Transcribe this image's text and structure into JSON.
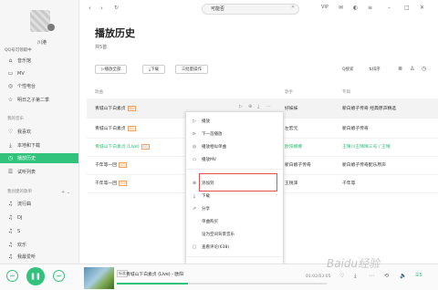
{
  "sidebar": {
    "username": "川港",
    "vip_text": "QQ号可领取中",
    "items_top": [
      {
        "label": "音乐馆",
        "icon": "home-icon"
      },
      {
        "label": "MV",
        "icon": "mv-icon"
      },
      {
        "label": "个性电台",
        "icon": "radio-icon"
      },
      {
        "label": "明日之子第二季",
        "icon": "star-icon"
      }
    ],
    "section_mine": "我的音乐",
    "items_mine": [
      {
        "label": "我喜欢",
        "icon": "heart-icon"
      },
      {
        "label": "本地和下载",
        "icon": "download-icon"
      },
      {
        "label": "播放历史",
        "icon": "history-icon",
        "active": true
      },
      {
        "label": "试听列表",
        "icon": "list-icon"
      }
    ],
    "section_created": "我创建的歌单",
    "created_tools": "+ ⌄",
    "items_created": [
      {
        "label": "流行曲",
        "icon": "note-icon"
      },
      {
        "label": "DJ",
        "icon": "note-icon"
      },
      {
        "label": "S",
        "icon": "note-icon"
      },
      {
        "label": "欢乐",
        "icon": "note-icon"
      },
      {
        "label": "我最爱听",
        "icon": "note-icon"
      }
    ]
  },
  "topbar": {
    "back": "‹",
    "forward": "›",
    "refresh": "↻",
    "search_value": "可能否",
    "search_clear": "✕",
    "vip": "VIP"
  },
  "main": {
    "title": "播放历史",
    "count": "共5首",
    "play_all": "▷播放全部",
    "download": "⤓下载",
    "batch": "☰批量操作",
    "search_tool": "Q搜索",
    "sort_tool": "⇅排序",
    "headers": {
      "song": "歌曲",
      "singer": "歌手",
      "album": "专辑"
    },
    "rows": [
      {
        "song": "青城山下白素贞",
        "tag": "SQ",
        "singer": "好妹妹",
        "album": "新白娘子传奇 经典原声精选"
      },
      {
        "song": "青城山下白素贞",
        "tag": "SQ",
        "singer": "左宏元",
        "album": "新白娘子传奇"
      },
      {
        "song": "青城山下白素贞 (Live)",
        "tag": "SQ",
        "singer": "欧阳娜娜",
        "album": "王晴川王晴晴三号 / 王晴"
      },
      {
        "song": "千年等一回",
        "tag": "SQ",
        "singer": "新白娘子传奇",
        "album": "新白娘子传奇配乐原声"
      },
      {
        "song": "千年等一回",
        "tag": "SQ",
        "singer": "王锐泽",
        "album": "千年等"
      }
    ]
  },
  "context_menu": {
    "items": [
      {
        "label": "播放",
        "icon": "play-icon"
      },
      {
        "label": "下一首播放",
        "icon": "next-icon"
      },
      {
        "label": "播放相似单曲",
        "icon": "similar-icon"
      },
      {
        "label": "播放MV",
        "icon": "mv-icon"
      },
      {
        "label": "添加到",
        "icon": "add-icon",
        "submenu": true
      },
      {
        "label": "下载",
        "icon": "download-icon",
        "submenu": true
      },
      {
        "label": "分享",
        "icon": "share-icon"
      },
      {
        "label": "单曲购买",
        "icon": ""
      },
      {
        "label": "设为空间背景音乐",
        "icon": ""
      },
      {
        "label": "查看评论(638)",
        "icon": "comment-icon"
      },
      {
        "label": "删除",
        "icon": "delete-icon"
      },
      {
        "label": "复制歌曲信息",
        "icon": ""
      }
    ]
  },
  "player": {
    "badge": "标准",
    "now_playing": "青城山下白素贞 (Live) - 欧阳",
    "time": "01:02/03:05",
    "progress": 0.34,
    "count": "5"
  },
  "watermark": "Baidu经验"
}
